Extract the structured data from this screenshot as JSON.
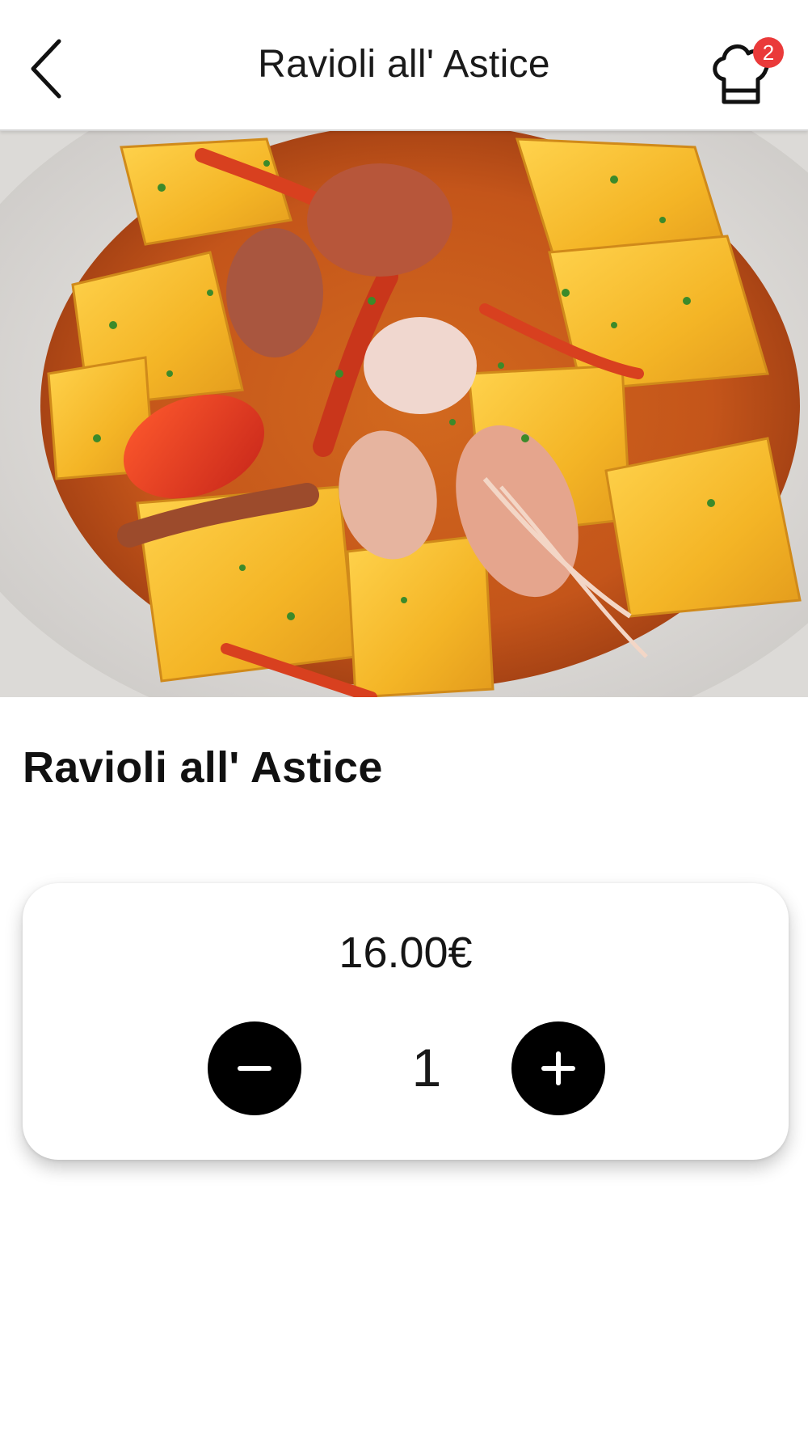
{
  "header": {
    "title": "Ravioli all' Astice",
    "back_icon": "chevron-left-icon",
    "cart_icon": "chef-hat-icon",
    "cart_badge_count": "2",
    "badge_color": "#ea3a3a"
  },
  "dish": {
    "title": "Ravioli all' Astice",
    "image_subject": "ravioli with lobster and tomato sauce"
  },
  "order": {
    "price": "16.00€",
    "quantity": "1",
    "minus_icon": "minus-icon",
    "plus_icon": "plus-icon"
  }
}
